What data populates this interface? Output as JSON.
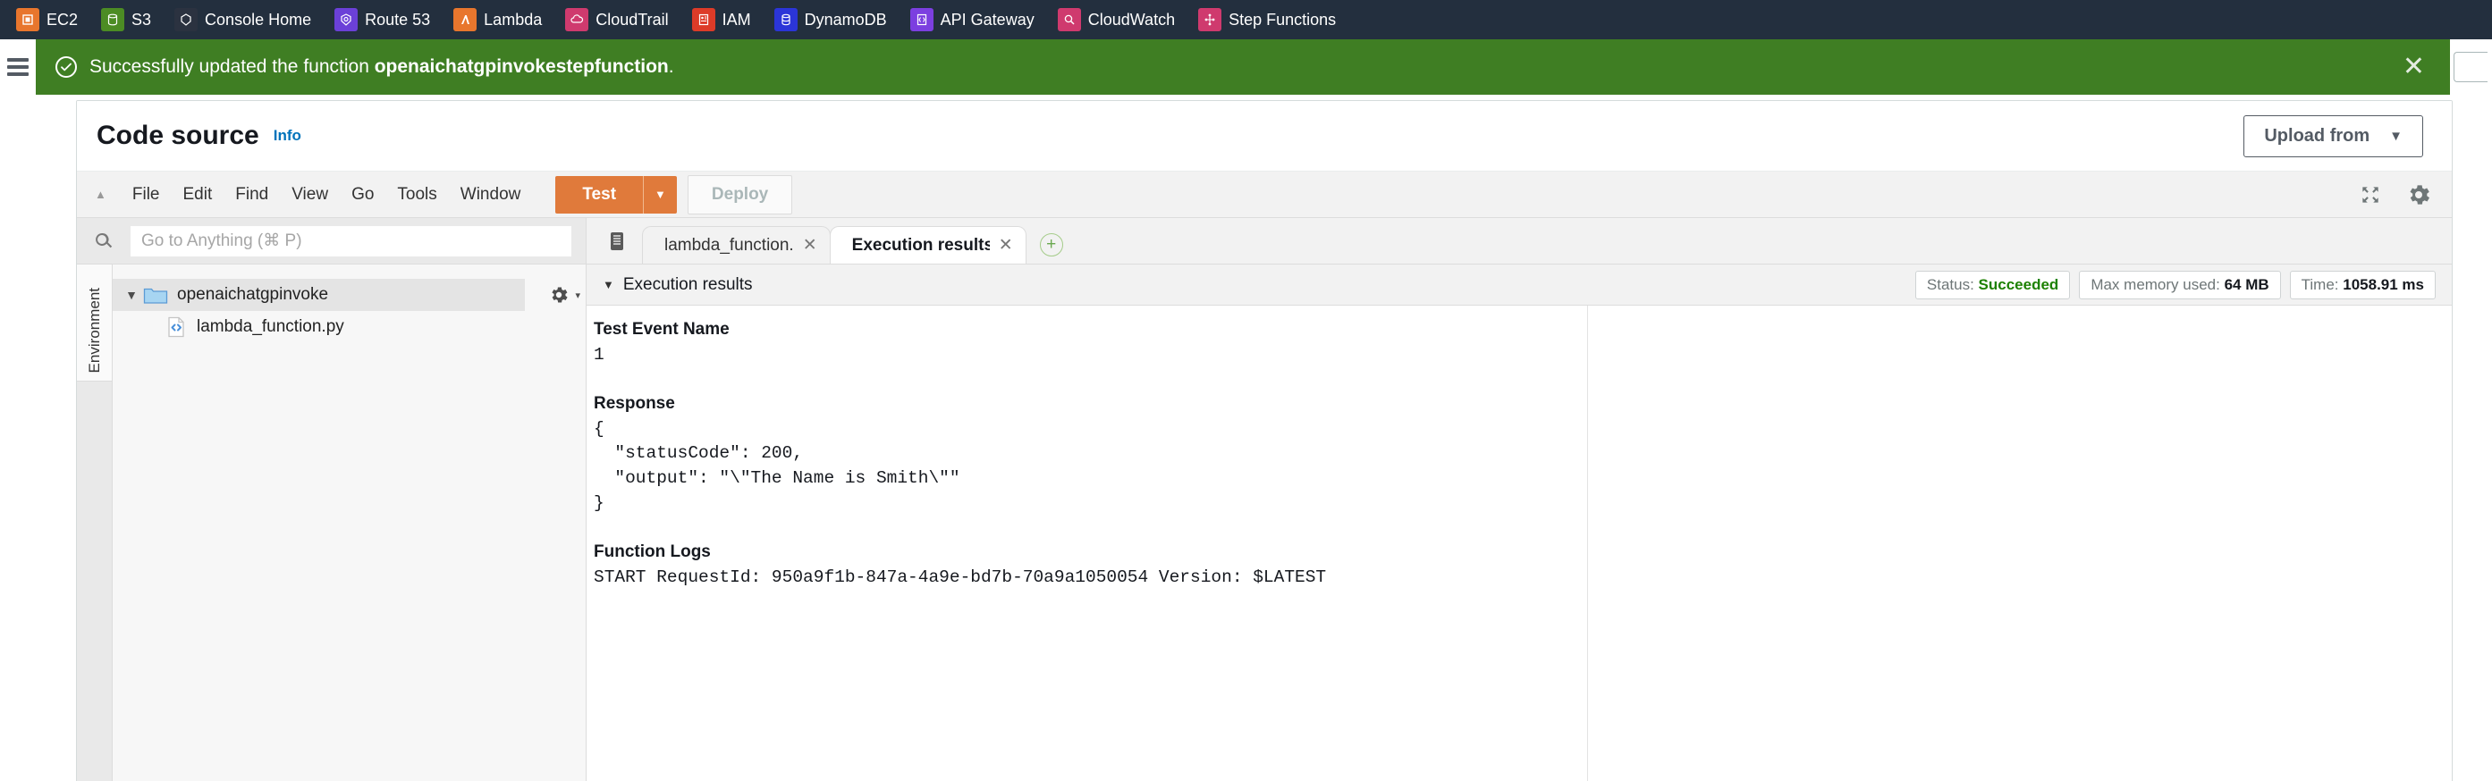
{
  "services_bar": {
    "items": [
      {
        "label": "EC2",
        "icon": "ec2-icon",
        "color": "#e8762d"
      },
      {
        "label": "S3",
        "icon": "s3-icon",
        "color": "#4c8c24"
      },
      {
        "label": "Console Home",
        "icon": "console-home-icon",
        "color": "#2b3240"
      },
      {
        "label": "Route 53",
        "icon": "route53-icon",
        "color": "#6b40d8"
      },
      {
        "label": "Lambda",
        "icon": "lambda-icon",
        "color": "#e8762d"
      },
      {
        "label": "CloudTrail",
        "icon": "cloudtrail-icon",
        "color": "#cf3a6e"
      },
      {
        "label": "IAM",
        "icon": "iam-icon",
        "color": "#dd3b28"
      },
      {
        "label": "DynamoDB",
        "icon": "dynamodb-icon",
        "color": "#2b35d8"
      },
      {
        "label": "API Gateway",
        "icon": "api-gateway-icon",
        "color": "#7c3fe0"
      },
      {
        "label": "CloudWatch",
        "icon": "cloudwatch-icon",
        "color": "#cf3a6e"
      },
      {
        "label": "Step Functions",
        "icon": "step-functions-icon",
        "color": "#cf3a6e"
      }
    ]
  },
  "flash": {
    "icon": "success-check-icon",
    "message_prefix": "Successfully updated the function ",
    "function_name": "openaichatgpinvokestepfunction",
    "message_suffix": ".",
    "close_label": "✕",
    "background": "#3f7e23"
  },
  "panel": {
    "title": "Code source",
    "info_link": "Info",
    "upload_button": "Upload from",
    "upload_caret": "▼"
  },
  "menubar": {
    "collapse_caret": "▲",
    "items": [
      "File",
      "Edit",
      "Find",
      "View",
      "Go",
      "Tools",
      "Window"
    ],
    "test_label": "Test",
    "test_caret": "▼",
    "deploy_label": "Deploy",
    "test_color": "#e07a3b",
    "icons": [
      "fullscreen-icon",
      "gear-icon"
    ]
  },
  "explorer": {
    "search_placeholder": "Go to Anything (⌘ P)",
    "search_value": "",
    "env_tab_label": "Environment",
    "folder": {
      "caret": "▼",
      "name": "openaichatgpinvoke",
      "gear_caret": "▾"
    },
    "file": {
      "name": "lambda_function.py"
    }
  },
  "editor": {
    "tabs": [
      {
        "label": "lambda_function.",
        "active": false,
        "close": "✕"
      },
      {
        "label": "Execution results",
        "active": true,
        "close": "✕"
      }
    ],
    "add_tab": "+"
  },
  "results": {
    "caret": "▼",
    "title": "Execution results",
    "badges": [
      {
        "label": "Status: ",
        "value": "Succeeded",
        "status": true
      },
      {
        "label": "Max memory used: ",
        "value": "64 MB",
        "status": false
      },
      {
        "label": "Time: ",
        "value": "1058.91 ms",
        "status": false
      }
    ],
    "output": {
      "test_event_name_heading": "Test Event Name",
      "test_event_name_value": "1",
      "response_heading": "Response",
      "response_body": "{\n  \"statusCode\": 200,\n  \"output\": \"\\\"The Name is Smith\\\"\"\n}",
      "function_logs_heading": "Function Logs",
      "function_logs_line1": "START RequestId: 950a9f1b-847a-4a9e-bd7b-70a9a1050054 Version: $LATEST"
    }
  }
}
